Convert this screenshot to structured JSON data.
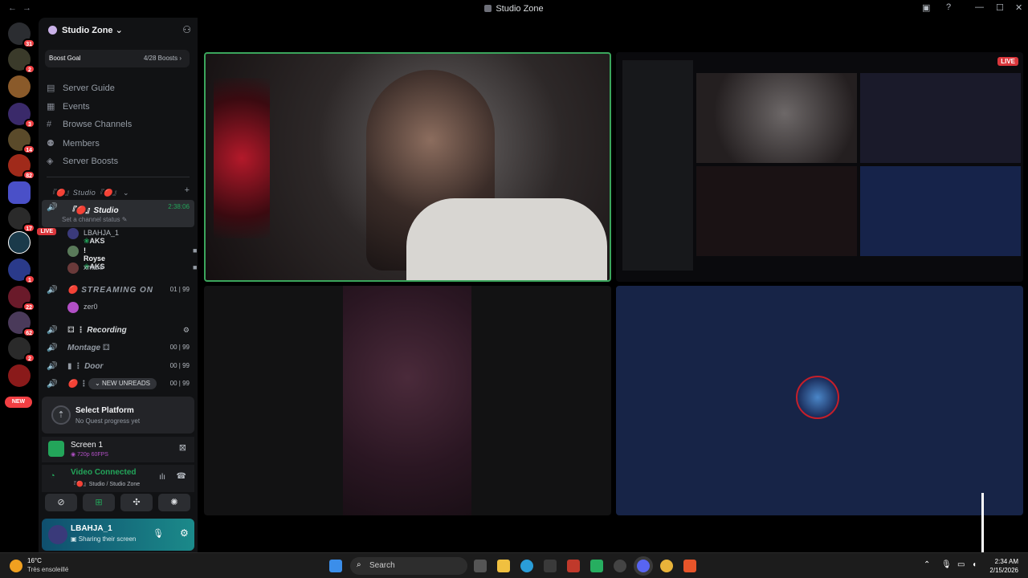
{
  "window": {
    "title": "Studio Zone"
  },
  "server": {
    "name": "Studio Zone",
    "boost_label": "Boost Goal",
    "boost_progress": "4/28 Boosts",
    "menu": [
      {
        "label": "Server Guide",
        "icon": "book-icon"
      },
      {
        "label": "Events",
        "icon": "calendar-icon"
      },
      {
        "label": "Browse Channels",
        "icon": "hash-list-icon"
      },
      {
        "label": "Members",
        "icon": "members-icon"
      },
      {
        "label": "Server Boosts",
        "icon": "boost-gem-icon"
      }
    ],
    "category": "『🔴』Studio『🔴』"
  },
  "guilds": {
    "badges": [
      "31",
      "2",
      "3",
      "14",
      "82",
      "17",
      "1",
      "22",
      "62",
      "2"
    ],
    "new_label": "NEW"
  },
  "channels": {
    "studio": {
      "name": "Studio",
      "timer": "2:38:06",
      "status": "Set a channel status"
    },
    "studio_users": [
      {
        "name": "LBAHJA_1",
        "tag": "AKS",
        "live": "LIVE"
      },
      {
        "name": "! Royse",
        "tag": "AKS"
      },
      {
        "name": "xmani"
      }
    ],
    "streaming": {
      "name": "STREAMING ON",
      "count_a": "01",
      "count_b": "99"
    },
    "streaming_users": [
      {
        "name": "zer0"
      }
    ],
    "recording": {
      "name": "Recording"
    },
    "montage": {
      "name": "Montage",
      "count_a": "00",
      "count_b": "99"
    },
    "door": {
      "name": "Door",
      "count_a": "00",
      "count_b": "99"
    },
    "last": {
      "name": "L",
      "count_a": "00",
      "count_b": "99"
    },
    "new_unreads": "NEW UNREADS"
  },
  "quest": {
    "title": "Select Platform",
    "subtitle": "No Quest progress yet"
  },
  "screen": {
    "title": "Screen 1",
    "quality": "720p 60FPS"
  },
  "voice": {
    "status": "Video Connected",
    "channel": "Studio / Studio Zone"
  },
  "user": {
    "name": "LBAHJA_1",
    "status": "Sharing their screen"
  },
  "stream": {
    "live": "LIVE"
  },
  "taskbar": {
    "weather_temp": "16°C",
    "weather_desc": "Très ensoleillé",
    "search": "Search",
    "time": "2:34 AM",
    "date": "2/15/2026"
  },
  "colors": {
    "accent_green": "#23a55a",
    "live_red": "#da373c",
    "blurple": "#5865f2"
  }
}
